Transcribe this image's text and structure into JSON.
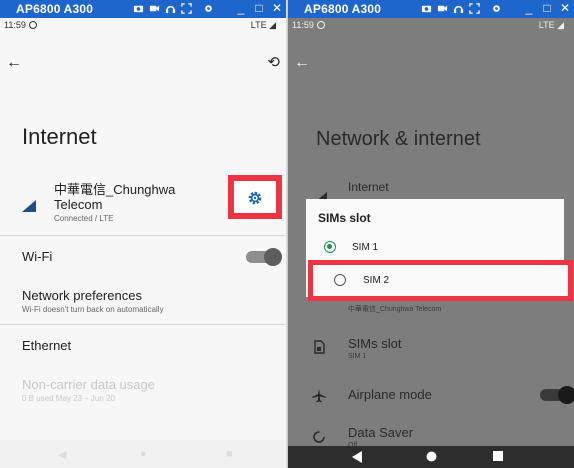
{
  "window": {
    "title": "AP6800 A300",
    "controls": [
      "minimize-icon",
      "maximize-icon",
      "close-icon"
    ],
    "accent": "#1f66cc",
    "highlight": "#ee3344"
  },
  "left": {
    "status": {
      "time": "11:59",
      "network": "LTE"
    },
    "title": "Internet",
    "carrier": {
      "name": "中華電信_Chunghwa Telecom",
      "status": "Connected / LTE"
    },
    "rows": {
      "wifi": {
        "label": "Wi-Fi"
      },
      "network_prefs": {
        "label": "Network preferences",
        "sub": "Wi-Fi doesn't turn back on automatically"
      },
      "ethernet": {
        "label": "Ethernet"
      },
      "non_carrier": {
        "label": "Non-carrier data usage",
        "sub": "0 B used May 23 – Jun 20"
      }
    }
  },
  "right": {
    "status": {
      "time": "11:59",
      "network": "LTE"
    },
    "title": "Network & internet",
    "internet_label": "Internet",
    "dialog": {
      "title": "SIMs slot",
      "options": [
        {
          "label": "SIM 1",
          "selected": true
        },
        {
          "label": "SIM 2",
          "selected": false
        }
      ]
    },
    "sim_sub": "中華電信_Chunghwa Telecom",
    "sims_slot": {
      "label": "SIMs slot",
      "sub": "SIM 1"
    },
    "airplane": {
      "label": "Airplane mode"
    },
    "data_saver": {
      "label": "Data Saver",
      "sub": "Off"
    }
  }
}
